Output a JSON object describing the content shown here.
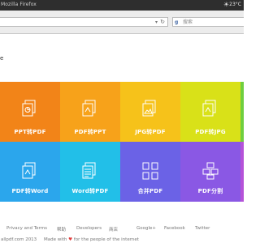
{
  "window": {
    "title": "Mozilla Firefox",
    "weather_icon": "sun-icon",
    "temperature": "23°C"
  },
  "toolbar": {
    "search_placeholder": "搜索",
    "search_engine_icon": "google-icon",
    "url_value": ""
  },
  "page": {
    "heading": "e",
    "tiles": [
      {
        "label": "PPT转PDF",
        "color": "#f28418"
      },
      {
        "label": "PDF转PPT",
        "color": "#f7a21a"
      },
      {
        "label": "JPG转PDF",
        "color": "#f6c21a"
      },
      {
        "label": "PDF转JPG",
        "color": "#d9e118"
      },
      {
        "label": "PDF转Word",
        "color": "#2ba6ec"
      },
      {
        "label": "Word转PDF",
        "color": "#22bfe8"
      },
      {
        "label": "合并PDF",
        "color": "#6b62e6"
      },
      {
        "label": "PDF分割",
        "color": "#8a58e4"
      }
    ]
  },
  "footer": {
    "links": [
      "Privacy and Terms",
      "帮助",
      "Developers",
      "商店",
      "Google+",
      "Facebook",
      "Twitter"
    ],
    "copyright": "allpdf.com 2013",
    "made_prefix": "Made with",
    "heart": "♥",
    "made_suffix": "for the people of the internet"
  }
}
